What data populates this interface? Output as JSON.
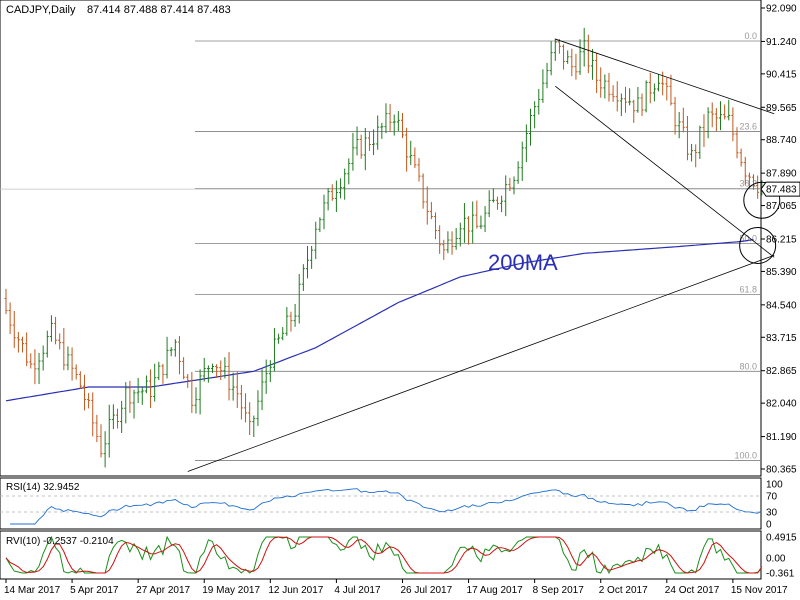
{
  "chart_data": {
    "type": "candlestick",
    "symbol_label": "CADJPY,Daily",
    "ohlc_header": "87.414 87.488 87.414 87.483",
    "current_price_label": "87.483",
    "current_price": 87.483,
    "ma_label": "200MA",
    "price_axis": {
      "min": 80.365,
      "max": 92.09,
      "ticks": [
        92.09,
        91.24,
        90.415,
        89.565,
        88.74,
        87.89,
        87.065,
        86.215,
        85.39,
        84.54,
        83.715,
        82.865,
        82.04,
        81.19,
        80.365
      ],
      "tick_labels": [
        "92.090",
        "91.240",
        "90.415",
        "89.565",
        "88.740",
        "87.890",
        "87.065",
        "86.215",
        "85.390",
        "84.540",
        "83.715",
        "82.865",
        "82.040",
        "81.190",
        "80.365"
      ]
    },
    "date_labels": [
      {
        "label": "14 Mar 2017",
        "bar": 0
      },
      {
        "label": "5 Apr 2017",
        "bar": 16
      },
      {
        "label": "27 Apr 2017",
        "bar": 32
      },
      {
        "label": "19 May 2017",
        "bar": 48
      },
      {
        "label": "12 Jun 2017",
        "bar": 64
      },
      {
        "label": "4 Jul 2017",
        "bar": 80
      },
      {
        "label": "26 Jul 2017",
        "bar": 96
      },
      {
        "label": "17 Aug 2017",
        "bar": 112
      },
      {
        "label": "8 Sep 2017",
        "bar": 128
      },
      {
        "label": "2 Oct 2017",
        "bar": 144
      },
      {
        "label": "24 Oct 2017",
        "bar": 160
      },
      {
        "label": "15 Nov 2017",
        "bar": 176
      }
    ],
    "fib_levels": [
      {
        "label": "0.0",
        "price": 91.25
      },
      {
        "label": "23.6",
        "price": 88.95
      },
      {
        "label": "38.2",
        "price": 87.5
      },
      {
        "label": "50.0",
        "price": 86.1
      },
      {
        "label": "61.8",
        "price": 84.8
      },
      {
        "label": "80.0",
        "price": 82.85
      },
      {
        "label": "100.0",
        "price": 80.58
      }
    ],
    "trendlines": [
      {
        "name": "upper-channel",
        "from": {
          "bar": 133,
          "price": 91.3
        },
        "to": {
          "bar": 186,
          "price": 89.4
        }
      },
      {
        "name": "lower-channel",
        "from": {
          "bar": 133,
          "price": 90.1
        },
        "to": {
          "bar": 186,
          "price": 85.75
        }
      },
      {
        "name": "long-support",
        "from": {
          "bar": 44,
          "price": 80.3
        },
        "to": {
          "bar": 186,
          "price": 85.8
        }
      }
    ],
    "circles": [
      {
        "bar": 183,
        "price": 87.2
      },
      {
        "bar": 182,
        "price": 86.05
      }
    ],
    "ma_anchors": [
      {
        "bar": 0,
        "price": 82.1
      },
      {
        "bar": 20,
        "price": 82.45
      },
      {
        "bar": 35,
        "price": 82.45
      },
      {
        "bar": 60,
        "price": 82.85
      },
      {
        "bar": 75,
        "price": 83.45
      },
      {
        "bar": 95,
        "price": 84.6
      },
      {
        "bar": 110,
        "price": 85.25
      },
      {
        "bar": 125,
        "price": 85.6
      },
      {
        "bar": 140,
        "price": 85.85
      },
      {
        "bar": 160,
        "price": 86.0
      },
      {
        "bar": 178,
        "price": 86.15
      },
      {
        "bar": 181,
        "price": 86.2
      }
    ],
    "close_anchors": [
      {
        "bar": 0,
        "price": 84.4
      },
      {
        "bar": 6,
        "price": 83.0
      },
      {
        "bar": 11,
        "price": 83.8
      },
      {
        "bar": 18,
        "price": 82.5
      },
      {
        "bar": 23,
        "price": 80.9
      },
      {
        "bar": 29,
        "price": 82.3
      },
      {
        "bar": 35,
        "price": 82.4
      },
      {
        "bar": 41,
        "price": 83.6
      },
      {
        "bar": 45,
        "price": 82.2
      },
      {
        "bar": 50,
        "price": 83.2
      },
      {
        "bar": 56,
        "price": 82.3
      },
      {
        "bar": 59,
        "price": 81.3
      },
      {
        "bar": 64,
        "price": 83.2
      },
      {
        "bar": 70,
        "price": 84.4
      },
      {
        "bar": 75,
        "price": 86.6
      },
      {
        "bar": 80,
        "price": 87.6
      },
      {
        "bar": 85,
        "price": 88.5
      },
      {
        "bar": 90,
        "price": 88.9
      },
      {
        "bar": 94,
        "price": 89.4
      },
      {
        "bar": 98,
        "price": 88.2
      },
      {
        "bar": 102,
        "price": 87.0
      },
      {
        "bar": 106,
        "price": 85.9
      },
      {
        "bar": 110,
        "price": 86.7
      },
      {
        "bar": 114,
        "price": 86.5
      },
      {
        "bar": 118,
        "price": 87.1
      },
      {
        "bar": 123,
        "price": 87.9
      },
      {
        "bar": 128,
        "price": 89.6
      },
      {
        "bar": 133,
        "price": 91.1
      },
      {
        "bar": 137,
        "price": 90.6
      },
      {
        "bar": 140,
        "price": 91.0
      },
      {
        "bar": 143,
        "price": 90.3
      },
      {
        "bar": 148,
        "price": 90.0
      },
      {
        "bar": 153,
        "price": 89.6
      },
      {
        "bar": 158,
        "price": 90.4
      },
      {
        "bar": 162,
        "price": 89.3
      },
      {
        "bar": 166,
        "price": 88.3
      },
      {
        "bar": 170,
        "price": 89.3
      },
      {
        "bar": 175,
        "price": 89.2
      },
      {
        "bar": 179,
        "price": 88.0
      },
      {
        "bar": 183,
        "price": 87.5
      }
    ],
    "rsi": {
      "label": "RSI(14) 32.9452",
      "period": 14,
      "last_value": 32.9452,
      "axis": {
        "min": 0,
        "max": 100,
        "ticks": [
          100,
          70,
          30,
          0
        ],
        "tick_labels": [
          "100",
          "70",
          "30",
          "0"
        ]
      },
      "levels": [
        70,
        30
      ]
    },
    "rvi": {
      "label": "RVI(10) -0.2537 -0.2104",
      "period": 10,
      "last_values": [
        -0.2537,
        -0.2104
      ],
      "axis": {
        "min": -0.361,
        "max": 0.4915,
        "ticks": [
          0.4915,
          0.0,
          -0.361
        ],
        "tick_labels": [
          "0.4915",
          "0.00",
          "-0.361"
        ]
      },
      "colors": {
        "main": "#1a8f1a",
        "signal": "#d01010"
      }
    },
    "colors": {
      "bull": "#1f7a1f",
      "bear": "#c0571c",
      "ma": "#2a2fb4",
      "grid": "#c0c0c0",
      "line": "#000000"
    }
  }
}
